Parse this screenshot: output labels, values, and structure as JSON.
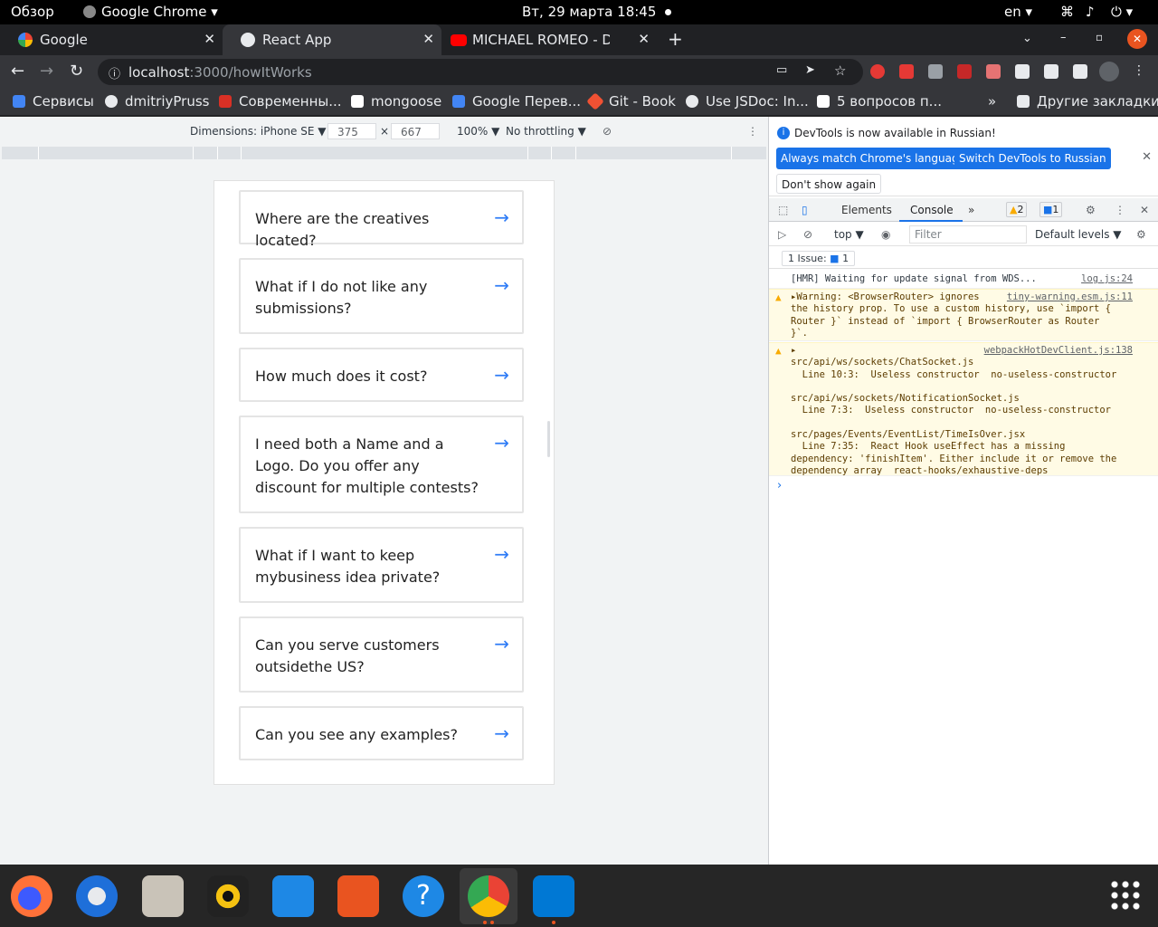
{
  "topbar": {
    "activities": "Обзор",
    "app_name": "Google Chrome ▾",
    "clock": "Вт, 29 марта  18:45",
    "lang": "en ▾"
  },
  "tabs": [
    {
      "title": "Google",
      "active": false
    },
    {
      "title": "React App",
      "active": true
    },
    {
      "title": "MICHAEL ROMEO - Div",
      "active": false
    }
  ],
  "new_tab": "+",
  "omnibox": {
    "host": "localhost",
    "path": ":3000/howItWorks"
  },
  "bookmarks": [
    "Сервисы",
    "dmitriyPruss",
    "Современны...",
    "mongoose",
    "Google Перев...",
    "Git - Book",
    "Use JSDoc: In...",
    "5 вопросов п...",
    "»",
    "Другие закладки"
  ],
  "device_toolbar": {
    "dimensions": "Dimensions: iPhone SE ▼",
    "width": "375",
    "times": "×",
    "height": "667",
    "zoom": "100% ▼",
    "throttling": "No throttling ▼"
  },
  "faq": [
    {
      "question": "Where are the creatives located?"
    },
    {
      "question": "What if I do not like any submissions?"
    },
    {
      "question": "How much does it cost?"
    },
    {
      "question": "I need both a Name and a Logo. Do you offer any discount for multiple contests?"
    },
    {
      "question": "What if I want to keep mybusiness idea private?"
    },
    {
      "question": "Can you serve customers outsidethe US?"
    },
    {
      "question": "Can you see any examples?"
    }
  ],
  "devtools": {
    "info": "DevTools is now available in Russian!",
    "btn_match": "Always match Chrome's language",
    "btn_switch": "Switch DevTools to Russian",
    "btn_dont": "Don't show again",
    "tab_elements": "Elements",
    "tab_console": "Console",
    "more_tabs": "»",
    "warn_count": "2",
    "msg_count": "1",
    "context": "top ▼",
    "filter_placeholder": "Filter",
    "levels": "Default levels ▼",
    "issues": "1 Issue:",
    "issues_count": "1",
    "logs": [
      {
        "text": "[HMR] Waiting for update signal from WDS...",
        "source": "log.js:24"
      },
      {
        "text": "▸Warning: <BrowserRouter> ignores\nthe history prop. To use a custom history, use `import {\nRouter }` instead of `import { BrowserRouter as Router\n}`.",
        "source": "tiny-warning.esm.js:11"
      },
      {
        "text": "▸\nsrc/api/ws/sockets/ChatSocket.js\n  Line 10:3:  Useless constructor  no-useless-constructor\n\nsrc/api/ws/sockets/NotificationSocket.js\n  Line 7:3:  Useless constructor  no-useless-constructor\n\nsrc/pages/Events/EventList/TimeIsOver.jsx\n  Line 7:35:  React Hook useEffect has a missing\ndependency: 'finishItem'. Either include it or remove the\ndependency array  react-hooks/exhaustive-deps",
        "source": "webpackHotDevClient.js:138"
      }
    ],
    "prompt": "›"
  },
  "colors": {
    "accent": "#1a73e8",
    "link_arrow": "#2f7cf6",
    "warn_bg": "#fffbe5"
  }
}
